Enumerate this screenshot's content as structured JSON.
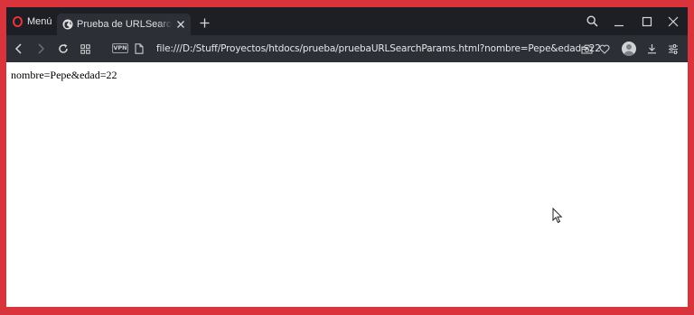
{
  "browser": {
    "menu_label": "Menú",
    "tab": {
      "title": "Prueba de URLSearchParams"
    },
    "vpn_badge": "VPN",
    "address": "file:///D:/Stuff/Proyectos/htdocs/prueba/pruebaURLSearchParams.html?nombre=Pepe&edad=22",
    "accent_color": "#e8323c",
    "icons": {
      "tab_favicon": "globe-icon",
      "new_tab": "plus-icon",
      "search": "search-icon",
      "minimize": "minimize-icon",
      "maximize": "maximize-icon",
      "close": "close-icon",
      "back": "back-icon",
      "forward": "forward-icon",
      "reload": "reload-icon",
      "tabs_grid": "grid-icon",
      "page": "page-icon",
      "snapshot": "camera-icon",
      "bookmark": "heart-icon",
      "profile": "avatar-icon",
      "downloads": "download-icon",
      "easy_setup": "sliders-icon"
    }
  },
  "page": {
    "body_text": "nombre=Pepe&edad=22"
  }
}
